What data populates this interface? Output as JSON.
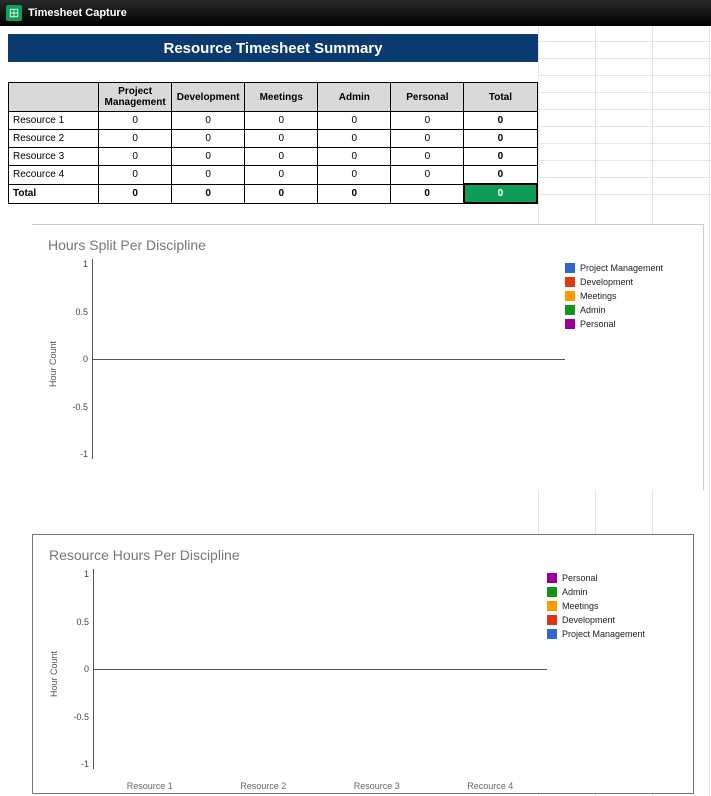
{
  "header": {
    "doc_title": "Timesheet Capture"
  },
  "summary_title": "Resource Timesheet Summary",
  "columns": [
    "Project Management",
    "Development",
    "Meetings",
    "Admin",
    "Personal",
    "Total"
  ],
  "rows": [
    {
      "name": "Resource 1",
      "values": [
        0,
        0,
        0,
        0,
        0
      ],
      "total": 0
    },
    {
      "name": "Resource 2",
      "values": [
        0,
        0,
        0,
        0,
        0
      ],
      "total": 0
    },
    {
      "name": "Resource 3",
      "values": [
        0,
        0,
        0,
        0,
        0
      ],
      "total": 0
    },
    {
      "name": "Recource 4",
      "values": [
        0,
        0,
        0,
        0,
        0
      ],
      "total": 0
    }
  ],
  "totals": {
    "label": "Total",
    "values": [
      0,
      0,
      0,
      0,
      0
    ],
    "grand": 0
  },
  "chart_data": [
    {
      "type": "bar",
      "title": "Hours Split Per Discipline",
      "ylabel": "Hour Count",
      "ylim": [
        -1,
        1
      ],
      "yticks": [
        1,
        0.5,
        0,
        -0.5,
        -1
      ],
      "categories": [],
      "series": [
        {
          "name": "Project Management",
          "color": "#3366cc",
          "values": []
        },
        {
          "name": "Development",
          "color": "#dc3912",
          "values": []
        },
        {
          "name": "Meetings",
          "color": "#ff9900",
          "values": []
        },
        {
          "name": "Admin",
          "color": "#109618",
          "values": []
        },
        {
          "name": "Personal",
          "color": "#990099",
          "values": []
        }
      ]
    },
    {
      "type": "bar",
      "title": "Resource Hours Per Discipline",
      "ylabel": "Hour Count",
      "ylim": [
        -1,
        1
      ],
      "yticks": [
        1,
        0.5,
        0,
        -0.5,
        -1
      ],
      "categories": [
        "Resource 1",
        "Resource 2",
        "Resource 3",
        "Recource 4"
      ],
      "series": [
        {
          "name": "Personal",
          "color": "#990099",
          "values": [
            0,
            0,
            0,
            0
          ]
        },
        {
          "name": "Admin",
          "color": "#109618",
          "values": [
            0,
            0,
            0,
            0
          ]
        },
        {
          "name": "Meetings",
          "color": "#ff9900",
          "values": [
            0,
            0,
            0,
            0
          ]
        },
        {
          "name": "Development",
          "color": "#dc3912",
          "values": [
            0,
            0,
            0,
            0
          ]
        },
        {
          "name": "Project Management",
          "color": "#3366cc",
          "values": [
            0,
            0,
            0,
            0
          ]
        }
      ]
    }
  ]
}
